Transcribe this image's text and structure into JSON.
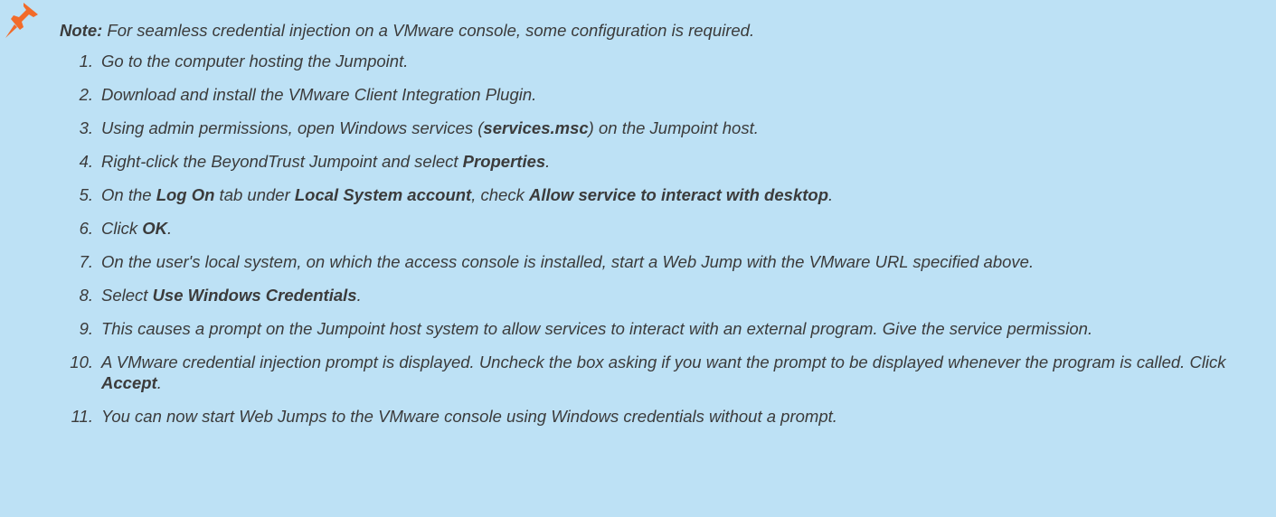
{
  "note": {
    "label": "Note:",
    "text": " For seamless credential injection on a VMware console, some configuration is required."
  },
  "colors": {
    "background": "#bde1f5",
    "text": "#3b3b3b",
    "pin": "#f26b2a"
  },
  "icon": "pushpin-icon",
  "steps": [
    {
      "number": "1.",
      "parts": [
        {
          "t": "Go to the computer hosting the Jumpoint.",
          "b": false
        }
      ]
    },
    {
      "number": "2.",
      "parts": [
        {
          "t": "Download and install the VMware Client Integration Plugin.",
          "b": false
        }
      ]
    },
    {
      "number": "3.",
      "parts": [
        {
          "t": "Using admin permissions, open Windows services (",
          "b": false
        },
        {
          "t": "services.msc",
          "b": true
        },
        {
          "t": ") on the Jumpoint host.",
          "b": false
        }
      ]
    },
    {
      "number": "4.",
      "parts": [
        {
          "t": "Right-click the BeyondTrust Jumpoint and select ",
          "b": false
        },
        {
          "t": "Properties",
          "b": true
        },
        {
          "t": ".",
          "b": false
        }
      ]
    },
    {
      "number": "5.",
      "parts": [
        {
          "t": "On the ",
          "b": false
        },
        {
          "t": "Log On",
          "b": true
        },
        {
          "t": " tab under ",
          "b": false
        },
        {
          "t": "Local System account",
          "b": true
        },
        {
          "t": ", check ",
          "b": false
        },
        {
          "t": "Allow service to interact with desktop",
          "b": true
        },
        {
          "t": ".",
          "b": false
        }
      ]
    },
    {
      "number": "6.",
      "parts": [
        {
          "t": "Click ",
          "b": false
        },
        {
          "t": "OK",
          "b": true
        },
        {
          "t": ".",
          "b": false
        }
      ]
    },
    {
      "number": "7.",
      "parts": [
        {
          "t": "On the user's local system, on which the access console is installed, start a Web Jump with the VMware URL specified above.",
          "b": false
        }
      ]
    },
    {
      "number": "8.",
      "parts": [
        {
          "t": "Select ",
          "b": false
        },
        {
          "t": "Use Windows Credentials",
          "b": true
        },
        {
          "t": ".",
          "b": false
        }
      ]
    },
    {
      "number": "9.",
      "parts": [
        {
          "t": "This causes a prompt on the Jumpoint host system to allow services to interact with an external program. Give the service permission.",
          "b": false
        }
      ]
    },
    {
      "number": "10.",
      "parts": [
        {
          "t": "A VMware credential injection prompt is displayed. Uncheck the box asking if you want the prompt to be displayed whenever the program is called. Click ",
          "b": false
        },
        {
          "t": "Accept",
          "b": true
        },
        {
          "t": ".",
          "b": false
        }
      ]
    },
    {
      "number": "11.",
      "parts": [
        {
          "t": "You can now start Web Jumps to the VMware console using Windows credentials without a prompt.",
          "b": false
        }
      ]
    }
  ]
}
